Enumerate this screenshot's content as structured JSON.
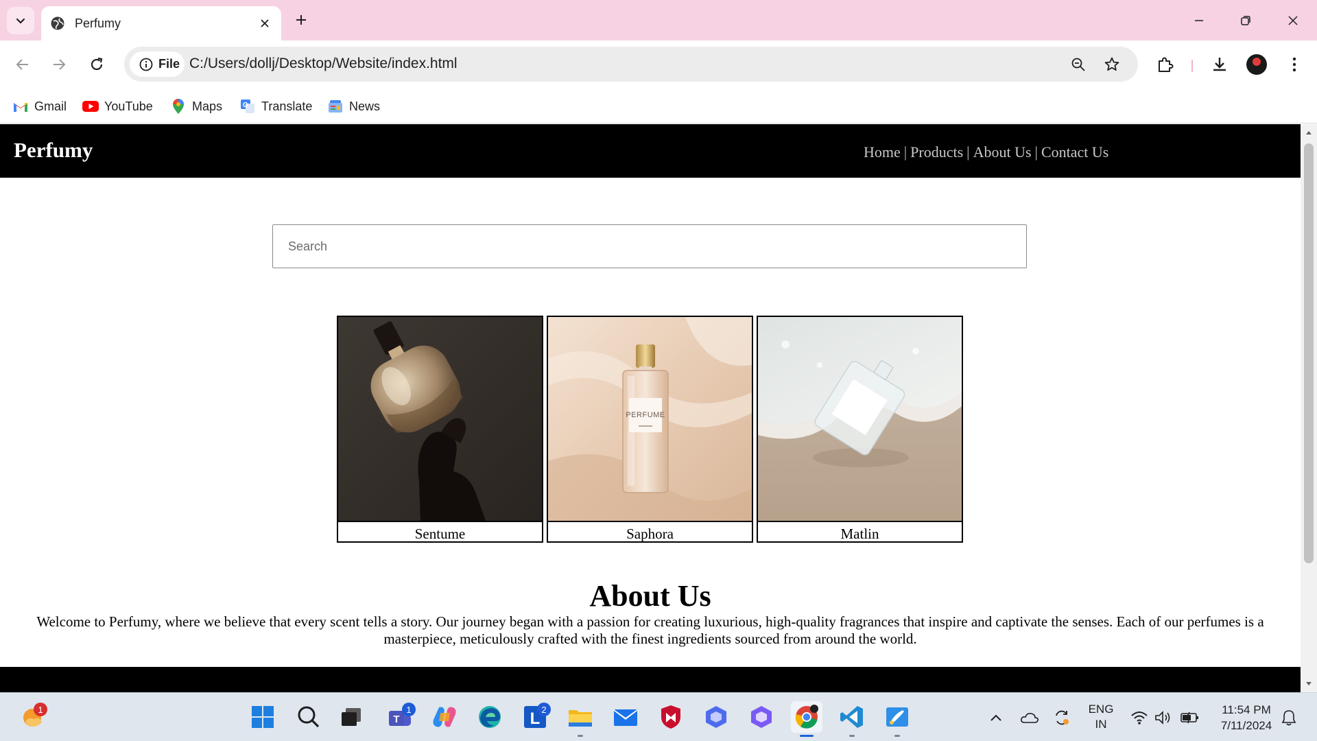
{
  "browser": {
    "tab_title": "Perfumy",
    "chip_label": "File",
    "url": "C:/Users/dollj/Desktop/Website/index.html",
    "bookmarks": [
      {
        "label": "Gmail",
        "icon": "gmail-icon"
      },
      {
        "label": "YouTube",
        "icon": "youtube-icon"
      },
      {
        "label": "Maps",
        "icon": "maps-icon"
      },
      {
        "label": "Translate",
        "icon": "translate-icon"
      },
      {
        "label": "News",
        "icon": "news-icon"
      }
    ],
    "accent_color": "#f6d2e2"
  },
  "site": {
    "logo": "Perfumy",
    "nav": [
      "Home",
      "Products",
      "About Us",
      "Contact Us"
    ],
    "nav_separator": "|",
    "search_placeholder": "Search",
    "products": [
      {
        "name": "Sentume",
        "image": "perfume-bottle-in-hand"
      },
      {
        "name": "Saphora",
        "image": "perfume-bottle-on-silk",
        "bottle_label": "PERFUME"
      },
      {
        "name": "Matlin",
        "image": "perfume-bottle-on-beach"
      }
    ],
    "about": {
      "title": "About Us",
      "text": "Welcome to Perfumy, where we believe that every scent tells a story. Our journey began with a passion for creating luxurious, high-quality fragrances that inspire and captivate the senses. Each of our perfumes is a masterpiece, meticulously crafted with the finest ingredients sourced from around the world."
    }
  },
  "taskbar": {
    "apps": [
      {
        "name": "start-icon"
      },
      {
        "name": "search-icon"
      },
      {
        "name": "task-view-icon"
      },
      {
        "name": "teams-icon",
        "badge": "1"
      },
      {
        "name": "copilot-icon"
      },
      {
        "name": "edge-icon"
      },
      {
        "name": "launcher-l-icon",
        "badge": "2"
      },
      {
        "name": "file-explorer-icon"
      },
      {
        "name": "mail-icon"
      },
      {
        "name": "mcafee-icon"
      },
      {
        "name": "app-hex-icon"
      },
      {
        "name": "app-hex-icon"
      },
      {
        "name": "chrome-icon"
      },
      {
        "name": "vscode-icon"
      },
      {
        "name": "paint-icon"
      }
    ],
    "widget_badge": "1",
    "language_line1": "ENG",
    "language_line2": "IN",
    "time": "11:54 PM",
    "date": "7/11/2024"
  }
}
